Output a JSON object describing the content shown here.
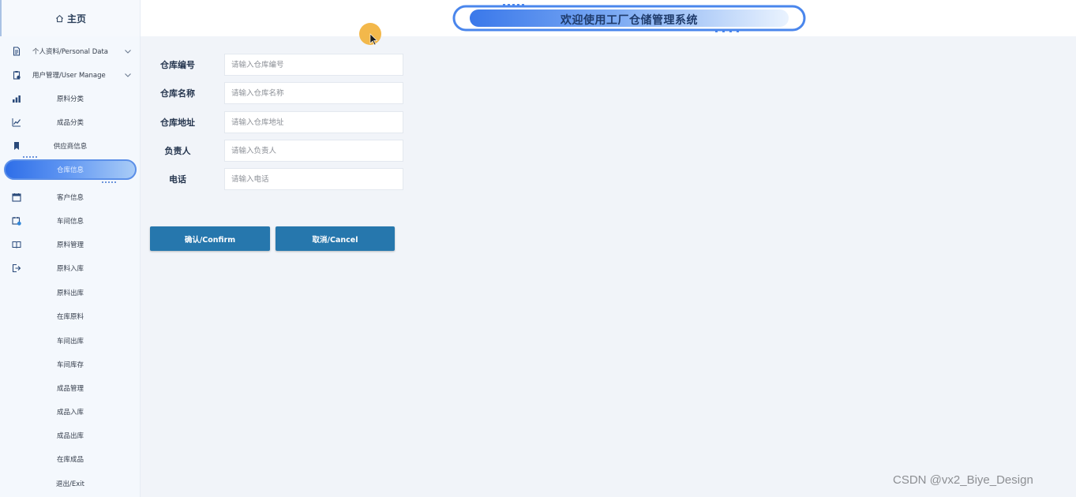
{
  "sidebar": {
    "home_label": "主页",
    "items": [
      {
        "label": "个人资料/Personal Data",
        "icon": "document-icon",
        "has_chevron": true
      },
      {
        "label": "用户管理/User Manage",
        "icon": "clipboard-icon",
        "has_chevron": true
      },
      {
        "label": "原料分类",
        "icon": "bar-chart-icon"
      },
      {
        "label": "成品分类",
        "icon": "line-chart-icon"
      },
      {
        "label": "供应商信息",
        "icon": "bookmark-icon"
      },
      {
        "label": "仓库信息",
        "icon": "",
        "active": true
      },
      {
        "label": "客户信息",
        "icon": "calendar-icon"
      },
      {
        "label": "车间信息",
        "icon": "calendar-check-icon"
      },
      {
        "label": "原料管理",
        "icon": "book-icon"
      },
      {
        "label": "原料入库",
        "icon": "sign-out-icon"
      },
      {
        "label": "原料出库",
        "icon": ""
      },
      {
        "label": "在库原料",
        "icon": ""
      },
      {
        "label": "车间出库",
        "icon": ""
      },
      {
        "label": "车间库存",
        "icon": ""
      },
      {
        "label": "成品管理",
        "icon": ""
      },
      {
        "label": "成品入库",
        "icon": ""
      },
      {
        "label": "成品出库",
        "icon": ""
      },
      {
        "label": "在库成品",
        "icon": ""
      },
      {
        "label": "退出/Exit",
        "icon": ""
      }
    ]
  },
  "header": {
    "title": "欢迎使用工厂仓储管理系统"
  },
  "form": {
    "fields": [
      {
        "label": "仓库编号",
        "placeholder": "请输入仓库编号",
        "value": ""
      },
      {
        "label": "仓库名称",
        "placeholder": "请输入仓库名称",
        "value": ""
      },
      {
        "label": "仓库地址",
        "placeholder": "请输入仓库地址",
        "value": ""
      },
      {
        "label": "负责人",
        "placeholder": "请输入负责人",
        "value": ""
      },
      {
        "label": "电话",
        "placeholder": "请输入电话",
        "value": ""
      }
    ],
    "confirm_label": "确认/Confirm",
    "cancel_label": "取消/Cancel"
  },
  "watermark": "CSDN @vx2_Biye_Design",
  "colors": {
    "button": "#2677ad",
    "active_pill": "#2e6ee8",
    "sidebar_bg": "#f4f8fd",
    "page_bg": "#f1f4f9"
  }
}
